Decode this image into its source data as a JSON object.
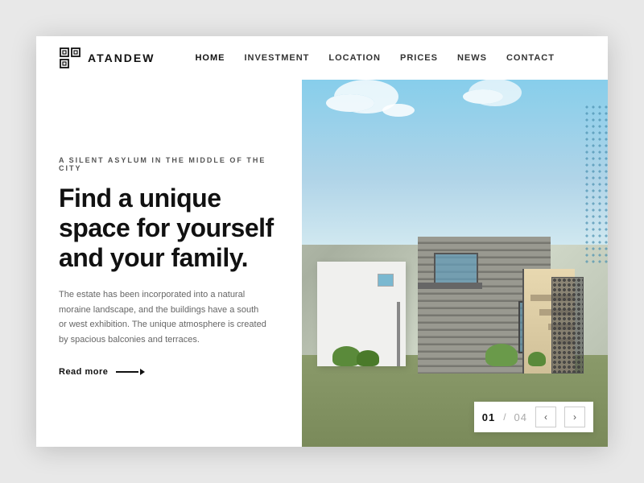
{
  "brand": {
    "name": "ATANDEW",
    "logo_alt": "Atandew Logo"
  },
  "nav": {
    "items": [
      {
        "label": "HOME",
        "active": true
      },
      {
        "label": "INVESTMENT",
        "active": false
      },
      {
        "label": "LOCATION",
        "active": false
      },
      {
        "label": "PRICES",
        "active": false
      },
      {
        "label": "NEWS",
        "active": false
      },
      {
        "label": "CONTACT",
        "active": false
      }
    ]
  },
  "hero": {
    "subtitle": "A SILENT ASYLUM IN THE MIDDLE OF THE CITY",
    "headline": "Find a unique space for yourself and your family.",
    "description": "The estate has been incorporated into a natural moraine landscape, and the buildings have a south or west exhibition. The unique atmosphere is created by spacious balconies and terraces.",
    "read_more_label": "Read more"
  },
  "slider": {
    "current": "01",
    "divider": "/",
    "total": "04",
    "prev_label": "‹",
    "next_label": "›"
  }
}
